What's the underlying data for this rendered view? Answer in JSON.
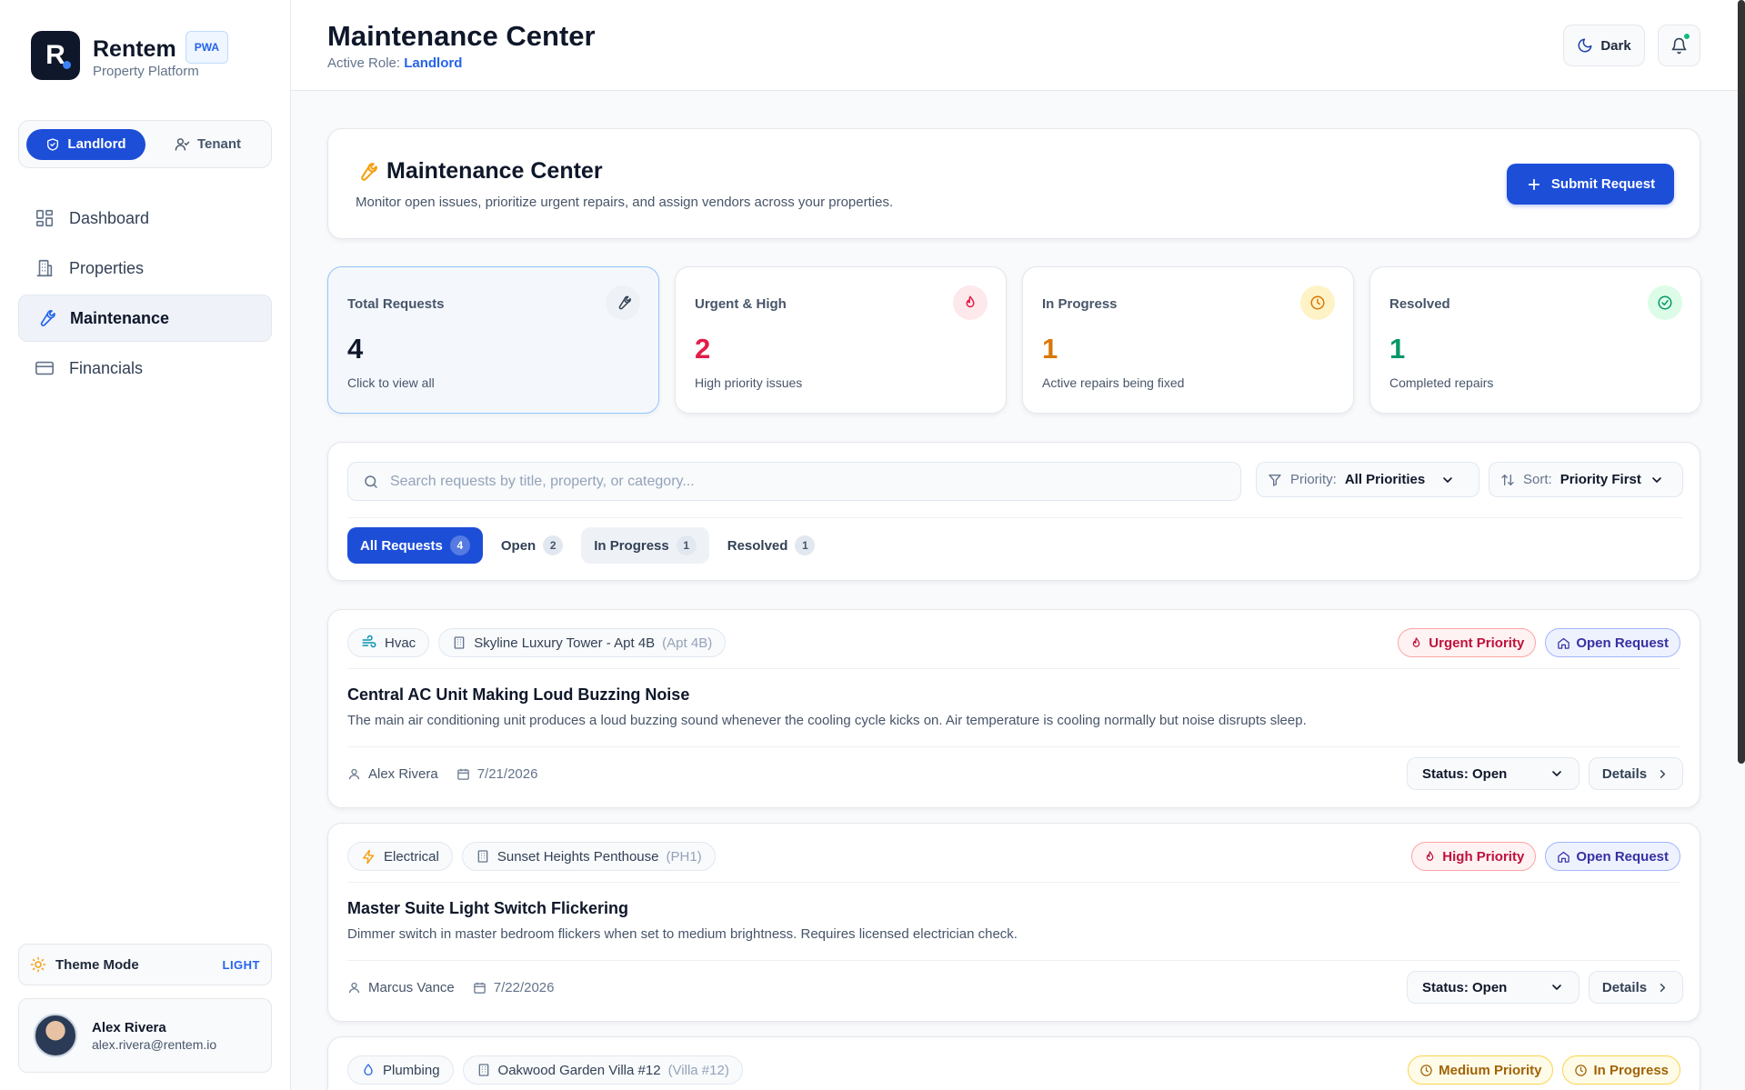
{
  "brand": {
    "logo_letter": "R",
    "name": "Rentem",
    "badge": "PWA",
    "subtitle": "Property Platform"
  },
  "roles": {
    "landlord": "Landlord",
    "tenant": "Tenant"
  },
  "nav": [
    {
      "label": "Dashboard",
      "icon": "grid-icon"
    },
    {
      "label": "Properties",
      "icon": "building-icon"
    },
    {
      "label": "Maintenance",
      "icon": "wrench-icon"
    },
    {
      "label": "Financials",
      "icon": "card-icon"
    }
  ],
  "theme": {
    "label": "Theme Mode",
    "value": "LIGHT"
  },
  "user": {
    "name": "Alex Rivera",
    "email": "alex.rivera@rentem.io"
  },
  "header": {
    "title": "Maintenance Center",
    "role_prefix": "Active Role:",
    "role": "Landlord",
    "dark_label": "Dark"
  },
  "hero": {
    "title": "Maintenance Center",
    "description": "Monitor open issues, prioritize urgent repairs, and assign vendors across your properties.",
    "submit_label": "Submit Request"
  },
  "stats": [
    {
      "label": "Total Requests",
      "value": "4",
      "desc": "Click to view all",
      "color": "#0f172a"
    },
    {
      "label": "Urgent & High",
      "value": "2",
      "desc": "High priority issues",
      "color": "#e11d48"
    },
    {
      "label": "In Progress",
      "value": "1",
      "desc": "Active repairs being fixed",
      "color": "#d97706"
    },
    {
      "label": "Resolved",
      "value": "1",
      "desc": "Completed repairs",
      "color": "#059669"
    }
  ],
  "filters": {
    "search_placeholder": "Search requests by title, property, or category...",
    "priority_label": "Priority:",
    "priority_value": "All Priorities",
    "sort_label": "Sort:",
    "sort_value": "Priority First"
  },
  "tabs": [
    {
      "label": "All Requests",
      "count": "4"
    },
    {
      "label": "Open",
      "count": "2"
    },
    {
      "label": "In Progress",
      "count": "1"
    },
    {
      "label": "Resolved",
      "count": "1"
    }
  ],
  "requests": [
    {
      "category": "Hvac",
      "property": "Skyline Luxury Tower - Apt 4B",
      "unit": "(Apt 4B)",
      "priority": "Urgent Priority",
      "status_badge": "Open Request",
      "title": "Central AC Unit Making Loud Buzzing Noise",
      "description": "The main air conditioning unit produces a loud buzzing sound whenever the cooling cycle kicks on. Air temperature is cooling normally but noise disrupts sleep.",
      "author": "Alex Rivera",
      "date": "7/21/2026",
      "status_select": "Status: Open",
      "details": "Details"
    },
    {
      "category": "Electrical",
      "property": "Sunset Heights Penthouse",
      "unit": "(PH1)",
      "priority": "High Priority",
      "status_badge": "Open Request",
      "title": "Master Suite Light Switch Flickering",
      "description": "Dimmer switch in master bedroom flickers when set to medium brightness. Requires licensed electrician check.",
      "author": "Marcus Vance",
      "date": "7/22/2026",
      "status_select": "Status: Open",
      "details": "Details"
    },
    {
      "category": "Plumbing",
      "property": "Oakwood Garden Villa #12",
      "unit": "(Villa #12)",
      "priority": "Medium Priority",
      "status_badge": "In Progress"
    }
  ]
}
